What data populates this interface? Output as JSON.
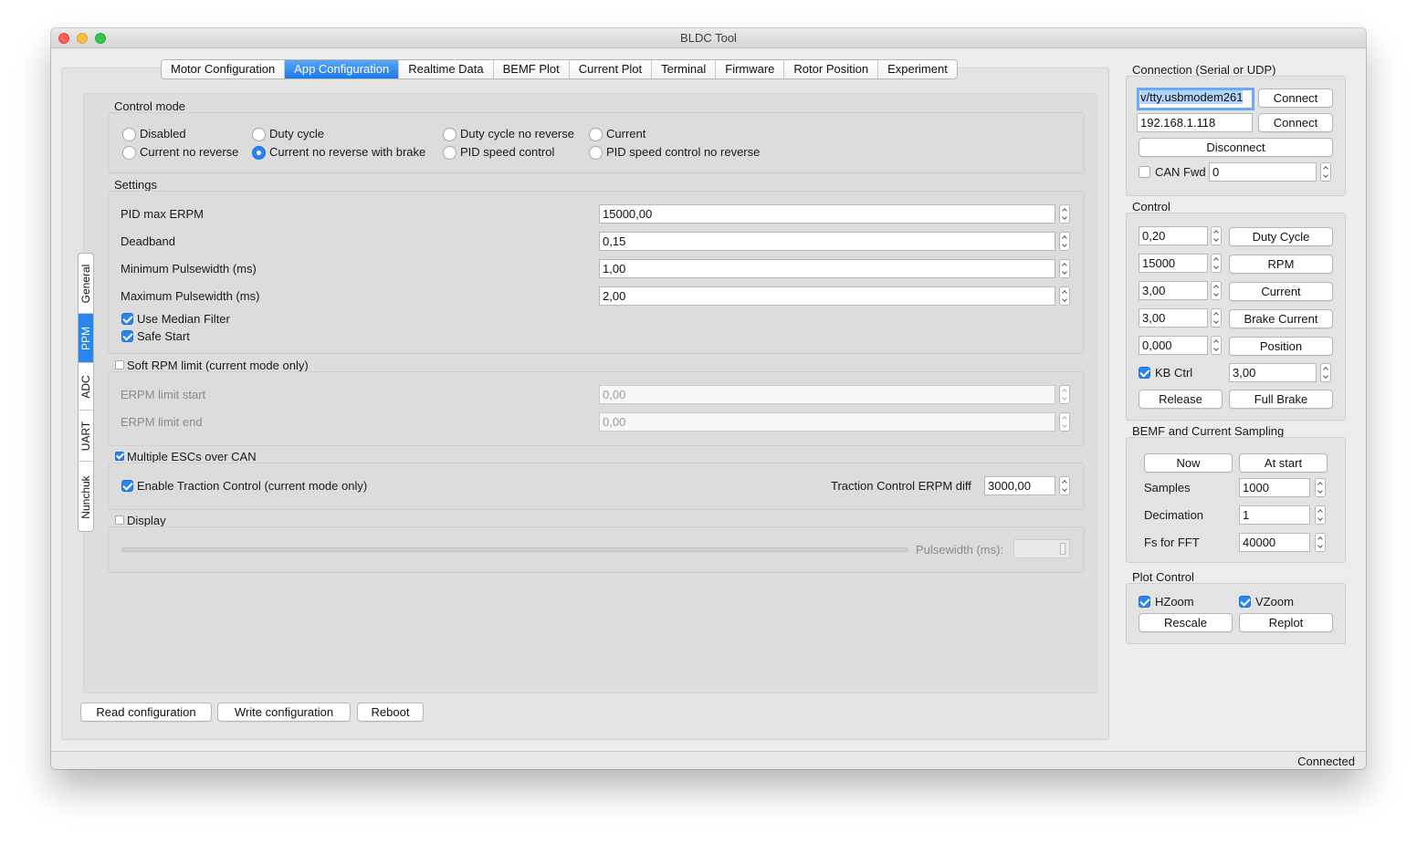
{
  "window": {
    "title": "BLDC Tool"
  },
  "tabs": [
    "Motor Configuration",
    "App Configuration",
    "Realtime Data",
    "BEMF Plot",
    "Current Plot",
    "Terminal",
    "Firmware",
    "Rotor Position",
    "Experiment"
  ],
  "active_tab": "App Configuration",
  "side_tabs": [
    "General",
    "PPM",
    "ADC",
    "UART",
    "Nunchuk"
  ],
  "active_side_tab": "PPM",
  "control_mode": {
    "title": "Control mode",
    "options": [
      "Disabled",
      "Duty cycle",
      "Duty cycle no reverse",
      "Current",
      "Current no reverse",
      "Current no reverse with brake",
      "PID speed control",
      "PID speed control no reverse"
    ],
    "selected": "Current no reverse with brake"
  },
  "settings": {
    "title": "Settings",
    "fields": [
      {
        "label": "PID max ERPM",
        "value": "15000,00"
      },
      {
        "label": "Deadband",
        "value": "0,15"
      },
      {
        "label": "Minimum Pulsewidth (ms)",
        "value": "1,00"
      },
      {
        "label": "Maximum Pulsewidth (ms)",
        "value": "2,00"
      }
    ],
    "checks": [
      {
        "label": "Use Median Filter",
        "checked": true
      },
      {
        "label": "Safe Start",
        "checked": true
      }
    ]
  },
  "soft_rpm": {
    "title": "Soft RPM limit (current mode only)",
    "checked": false,
    "fields": [
      {
        "label": "ERPM limit start",
        "value": "0,00"
      },
      {
        "label": "ERPM limit end",
        "value": "0,00"
      }
    ]
  },
  "multi_esc": {
    "title": "Multiple ESCs over CAN",
    "checked": true,
    "traction_label": "Enable Traction Control (current mode only)",
    "traction_checked": true,
    "erpm_diff_label": "Traction Control ERPM diff",
    "erpm_diff_value": "3000,00"
  },
  "display": {
    "title": "Display",
    "checked": false,
    "pulsewidth_label": "Pulsewidth (ms):"
  },
  "bottom_buttons": [
    "Read configuration",
    "Write configuration",
    "Reboot"
  ],
  "connection": {
    "title": "Connection (Serial or UDP)",
    "serial_port": "v/tty.usbmodem261",
    "udp_ip": "192.168.1.118",
    "connect_label": "Connect",
    "disconnect_label": "Disconnect",
    "can_fwd_label": "CAN Fwd",
    "can_fwd_checked": false,
    "can_fwd_value": "0"
  },
  "control": {
    "title": "Control",
    "rows": [
      {
        "value": "0,20",
        "button": "Duty Cycle"
      },
      {
        "value": "15000",
        "button": "RPM"
      },
      {
        "value": "3,00",
        "button": "Current"
      },
      {
        "value": "3,00",
        "button": "Brake Current"
      },
      {
        "value": "0,000",
        "button": "Position"
      }
    ],
    "kb_ctrl_label": "KB Ctrl",
    "kb_ctrl_checked": true,
    "kb_ctrl_value": "3,00",
    "release_label": "Release",
    "full_brake_label": "Full Brake"
  },
  "bemf": {
    "title": "BEMF and Current Sampling",
    "now_label": "Now",
    "at_start_label": "At start",
    "fields": [
      {
        "label": "Samples",
        "value": "1000"
      },
      {
        "label": "Decimation",
        "value": "1"
      },
      {
        "label": "Fs for FFT",
        "value": "40000"
      }
    ]
  },
  "plot_control": {
    "title": "Plot Control",
    "hzoom_label": "HZoom",
    "hzoom_checked": true,
    "vzoom_label": "VZoom",
    "vzoom_checked": true,
    "rescale_label": "Rescale",
    "replot_label": "Replot"
  },
  "status": "Connected",
  "colors": {
    "accent": "#2b83f0",
    "window_bg": "#ececec"
  }
}
